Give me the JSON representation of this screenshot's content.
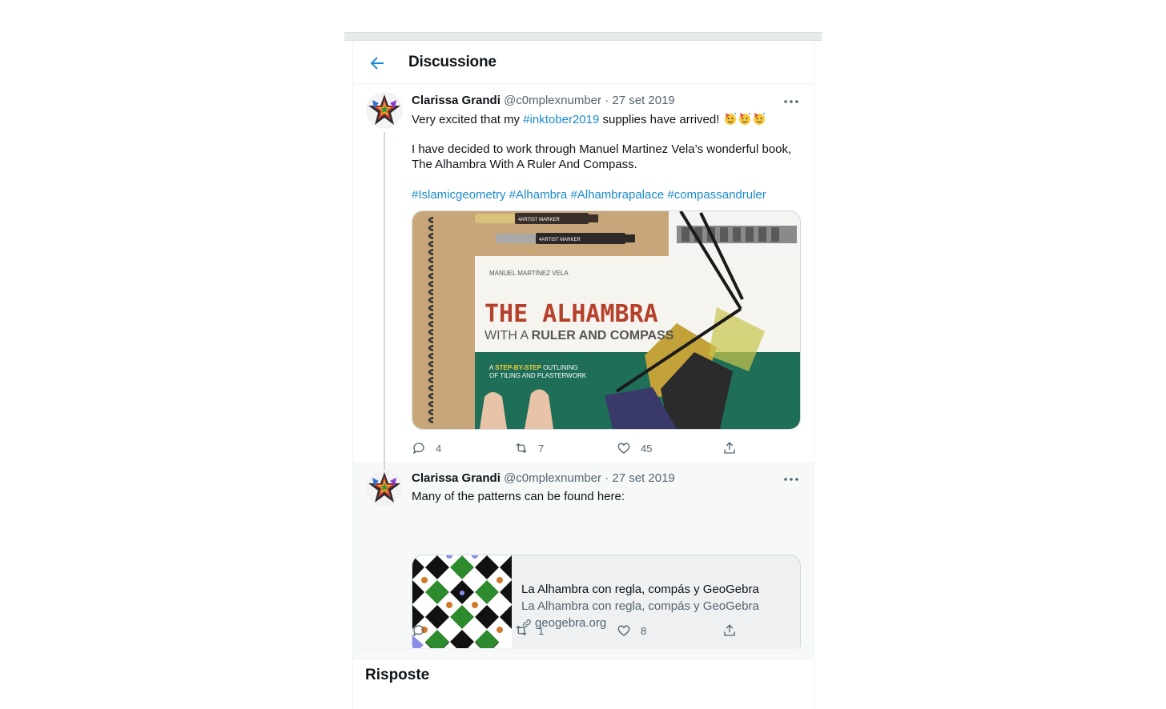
{
  "header": {
    "title": "Discussione",
    "back_icon": "arrow-left-icon"
  },
  "tweets": [
    {
      "author_name": "Clarissa Grandi",
      "handle": "@c0mplexnumber",
      "separator": "·",
      "date": "27 set 2019",
      "text_pre": "Very excited that my ",
      "hashtag": "#inktober2019",
      "text_post": " supplies have arrived!",
      "emojis": [
        "party-face",
        "party-face",
        "party-face"
      ],
      "paragraph2_line1": "I have decided to work through Manuel Martinez Vela’s wonderful book,",
      "paragraph2_line2": "The Alhambra With A Ruler And Compass.",
      "hashtags": [
        "#Islamicgeometry",
        "#Alhambra",
        "#Alhambrapalace",
        "#compassandruler"
      ],
      "image": {
        "author": "MANUEL MARTÍNEZ VELA",
        "title": "THE ALHAMBRA",
        "subtitle_pre": "WITH A ",
        "subtitle_bold": "RULER AND COMPASS",
        "tag_a": "A",
        "tag_step": "STEP-BY-STEP",
        "tag_rest": "OUTLINING",
        "tag_line2": "OF TILING AND PLASTERWORK",
        "marker_label": "4ARTIST MARKER"
      },
      "counts": {
        "replies": "4",
        "retweets": "7",
        "likes": "45"
      }
    },
    {
      "author_name": "Clarissa Grandi",
      "handle": "@c0mplexnumber",
      "separator": "·",
      "date": "27 set 2019",
      "text": "Many of the patterns can be found here:",
      "card": {
        "title": "La Alhambra con regla, compás y GeoGebra",
        "description": "La Alhambra con regla, compás y GeoGebra",
        "domain": "geogebra.org"
      },
      "counts": {
        "replies": "",
        "retweets": "1",
        "likes": "8"
      }
    }
  ],
  "replies_section": {
    "title": "Risposte"
  },
  "colors": {
    "link": "#1b8bd0",
    "text": "#0f1419",
    "muted": "#536471",
    "border": "#cfd9de"
  }
}
